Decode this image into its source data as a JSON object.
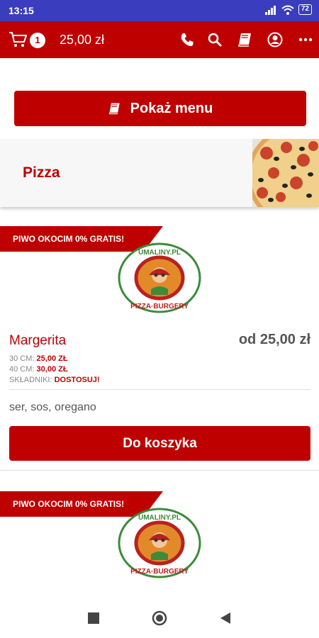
{
  "status": {
    "time": "13:15",
    "battery": "72"
  },
  "header": {
    "cart_count": "1",
    "cart_total": "25,00 zł"
  },
  "menu_button": {
    "label": "Pokaż menu"
  },
  "category": {
    "name": "Pizza"
  },
  "promo": {
    "label": "PIWO OKOCIM 0% GRATIS!"
  },
  "logo": {
    "text_top": "UMALINY.PL",
    "text_bottom": "PIZZA·BURGERY"
  },
  "item": {
    "name": "Margerita",
    "price": "od 25,00 zł",
    "size1_label": "30 CM:",
    "size1_price": "25,00 ZŁ",
    "size2_label": "40 CM:",
    "size2_price": "30,00 ZŁ",
    "ingredients_label": "SKŁADNIKI:",
    "ingredients_action": "DOSTOSUJ!",
    "description": "ser, sos, oregano",
    "cart_button": "Do koszyka"
  },
  "colors": {
    "brand": "#bf0000",
    "statusbar": "#3a3dbd"
  }
}
